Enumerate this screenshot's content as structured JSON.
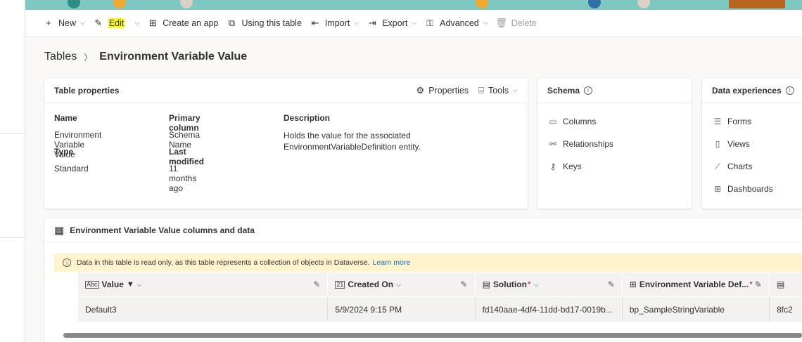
{
  "command_bar": {
    "new": "New",
    "edit": "Edit",
    "create_app": "Create an app",
    "using_table": "Using this table",
    "import": "Import",
    "export": "Export",
    "advanced": "Advanced",
    "delete": "Delete"
  },
  "breadcrumb": {
    "root": "Tables",
    "current": "Environment Variable Value"
  },
  "table_properties": {
    "title": "Table properties",
    "properties_btn": "Properties",
    "tools_btn": "Tools",
    "name_label": "Name",
    "name_value": "Environment Variable Value",
    "type_label": "Type",
    "type_value": "Standard",
    "primary_label": "Primary column",
    "primary_value": "Schema Name",
    "modified_label": "Last modified",
    "modified_value": "11 months ago",
    "desc_label": "Description",
    "desc_value": "Holds the value for the associated EnvironmentVariableDefinition entity."
  },
  "schema": {
    "title": "Schema",
    "items": [
      "Columns",
      "Relationships",
      "Keys"
    ]
  },
  "data_experiences": {
    "title": "Data experiences",
    "items": [
      "Forms",
      "Views",
      "Charts",
      "Dashboards"
    ]
  },
  "data_section": {
    "title": "Environment Variable Value columns and data",
    "notice": "Data in this table is read only, as this table represents a collection of objects in Dataverse.",
    "learn_more": "Learn more",
    "columns": [
      "Value",
      "Created On",
      "Solution",
      "Environment Variable Def..."
    ],
    "row": [
      "Default3",
      "5/9/2024 9:15 PM",
      "fd140aae-4df4-11dd-bd17-0019b...",
      "bp_SampleStringVariable",
      "8fc2"
    ]
  },
  "colors": {
    "accent": "#0f6cbd",
    "highlight": "#ffff00",
    "notice_bg": "#fff4ce"
  }
}
